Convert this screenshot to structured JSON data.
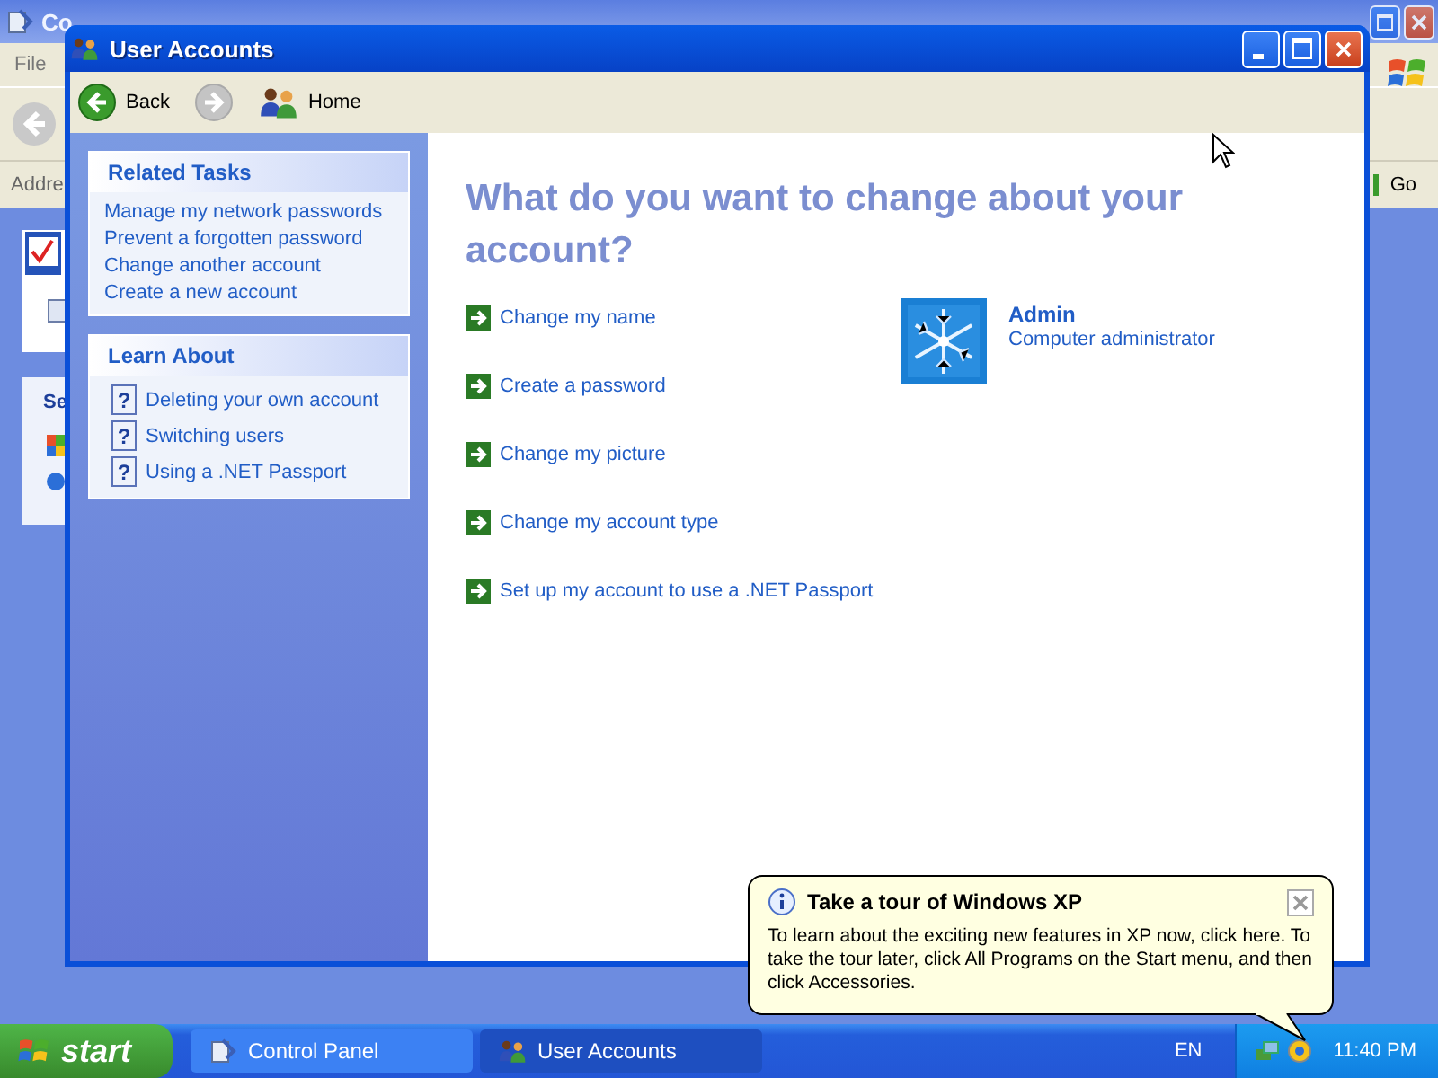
{
  "background_window": {
    "title": "Co",
    "menu": [
      "File"
    ],
    "address_label": "Addre",
    "go_button": "Go",
    "panel_heading": "Se"
  },
  "window": {
    "title": "User Accounts"
  },
  "toolbar": [
    {
      "kind": "back",
      "label": "Back",
      "disabled": false
    },
    {
      "kind": "forward",
      "disabled": true
    },
    {
      "kind": "home",
      "label": "Home",
      "disabled": false
    }
  ],
  "related_tasks": {
    "title": "Related Tasks",
    "items": [
      "Manage my network passwords",
      "Prevent a forgotten password",
      "Change another account",
      "Create a new account"
    ]
  },
  "learn_about": {
    "title": "Learn About",
    "items": [
      {
        "icon": "?",
        "label": "Deleting your own account"
      },
      {
        "icon": "?",
        "label": "Switching users"
      },
      {
        "icon": "?",
        "label": "Using a .NET Passport"
      }
    ]
  },
  "heading": "What do you want to change about your account?",
  "tasks": [
    "Change my name",
    "Create a password",
    "Change my picture",
    "Change my account type",
    "Set up my account to use a .NET Passport"
  ],
  "account": {
    "name": "Admin",
    "type": "Computer administrator"
  },
  "balloon": {
    "title": "Take a tour of Windows XP",
    "text": "To learn about the exciting new features in XP now, click here. To take the tour later, click All Programs on the Start menu, and then click Accessories."
  },
  "taskbar": {
    "start": "start",
    "tasks": [
      {
        "label": "Control Panel",
        "kind": "control-panel",
        "selected": false
      },
      {
        "label": "User Accounts",
        "kind": "users",
        "selected": true
      }
    ],
    "language": "EN",
    "clock": "11:40 PM"
  }
}
